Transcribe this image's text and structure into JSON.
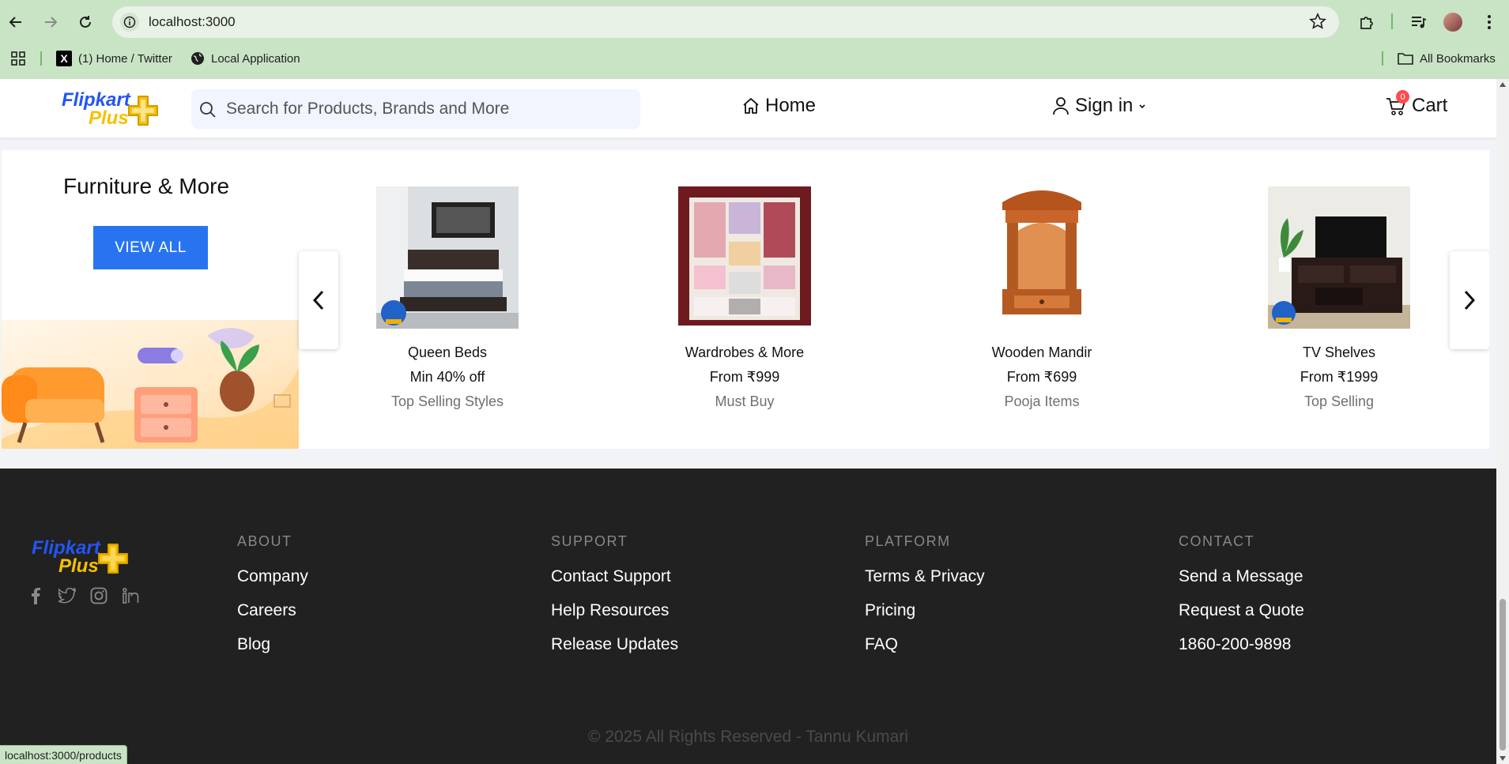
{
  "browser": {
    "url": "localhost:3000",
    "bookmarks": [
      {
        "label": "(1) Home / Twitter"
      },
      {
        "label": "Local Application"
      }
    ],
    "all_bookmarks": "All Bookmarks",
    "status_url": "localhost:3000/products"
  },
  "header": {
    "logo_line1": "Flipkart",
    "logo_line2": "Plus",
    "search_placeholder": "Search for Products, Brands and More",
    "home": "Home",
    "sign_in": "Sign in",
    "cart": "Cart",
    "cart_count": "0"
  },
  "section": {
    "title": "Furniture & More",
    "view_all": "VIEW ALL",
    "products": [
      {
        "name": "Queen Beds",
        "price": "Min 40% off",
        "tag": "Top Selling Styles"
      },
      {
        "name": "Wardrobes & More",
        "price": "From ₹999",
        "tag": "Must Buy"
      },
      {
        "name": "Wooden Mandir",
        "price": "From ₹699",
        "tag": "Pooja Items"
      },
      {
        "name": "TV Shelves",
        "price": "From ₹1999",
        "tag": "Top Selling"
      }
    ]
  },
  "footer": {
    "logo_line1": "Flipkart",
    "logo_line2": "Plus",
    "columns": [
      {
        "heading": "ABOUT",
        "links": [
          "Company",
          "Careers",
          "Blog"
        ]
      },
      {
        "heading": "SUPPORT",
        "links": [
          "Contact Support",
          "Help Resources",
          "Release Updates"
        ]
      },
      {
        "heading": "PLATFORM",
        "links": [
          "Terms & Privacy",
          "Pricing",
          "FAQ"
        ]
      },
      {
        "heading": "CONTACT",
        "links": [
          "Send a Message",
          "Request a Quote",
          "1860-200-9898"
        ]
      }
    ],
    "copyright": "© 2025 All Rights Reserved - Tannu Kumari"
  },
  "colors": {
    "brand_blue": "#2455f4",
    "brand_yellow": "#f8c000",
    "button_blue": "#2874f0",
    "footer_bg": "#212121"
  }
}
